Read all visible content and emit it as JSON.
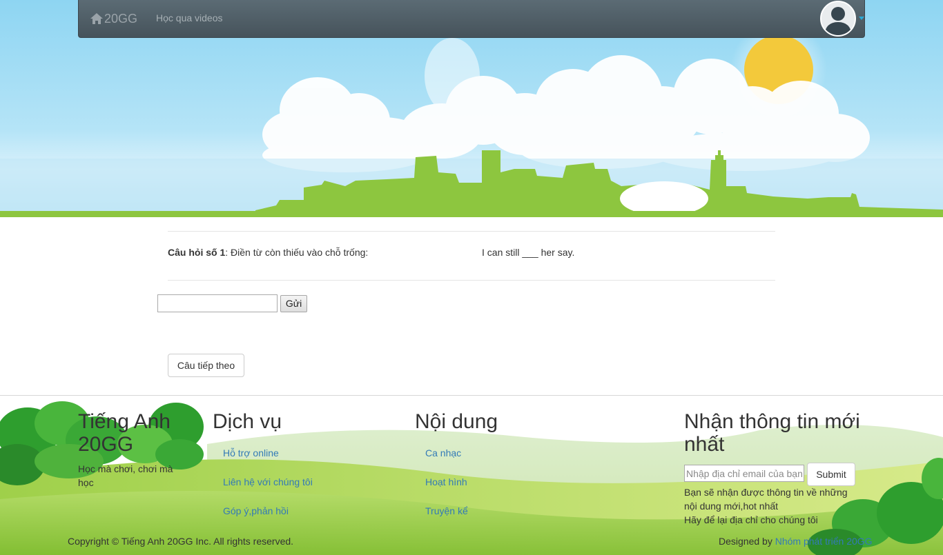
{
  "navbar": {
    "brand": "20GG",
    "link_videos": "Học qua videos"
  },
  "question": {
    "label_bold": "Câu hỏi số 1",
    "label_rest": ": Điền từ còn thiếu vào chỗ trống:",
    "sentence": "I can still ___ her say.",
    "answer_value": "",
    "send_label": "Gửi",
    "next_label": "Câu tiếp theo"
  },
  "footer": {
    "about": {
      "title": "Tiếng Anh 20GG",
      "tagline": "Học mà chơi, chơi mà học"
    },
    "services": {
      "title": "Dịch vụ",
      "links": [
        "Hỗ trợ online",
        "Liên hệ với chúng tôi",
        "Góp ý,phản hồi"
      ]
    },
    "content": {
      "title": "Nội dung",
      "links": [
        "Ca nhạc",
        "Hoạt hình",
        "Truyện kể"
      ]
    },
    "newsletter": {
      "title": "Nhận thông tin mới nhất",
      "email_placeholder": "Nhập địa chỉ email của bạn",
      "submit_label": "Submit",
      "note": "Bạn sẽ nhận được thông tin về những nội dung mới,hot nhất",
      "note2": "Hãy để lại địa chỉ cho chúng tôi"
    },
    "copyright": "Copyright © Tiếng Anh 20GG Inc. All rights reserved.",
    "designed_prefix": "Designed by ",
    "designed_link": "Nhóm phát triển 20GG"
  },
  "colors": {
    "navbar": "#4f5c64",
    "link": "#337ab7",
    "grass": "#8dc63f",
    "sun": "#f3c93b"
  },
  "icons": {
    "home": "home-icon",
    "avatar": "user-avatar-icon",
    "caret": "caret-down-icon"
  }
}
